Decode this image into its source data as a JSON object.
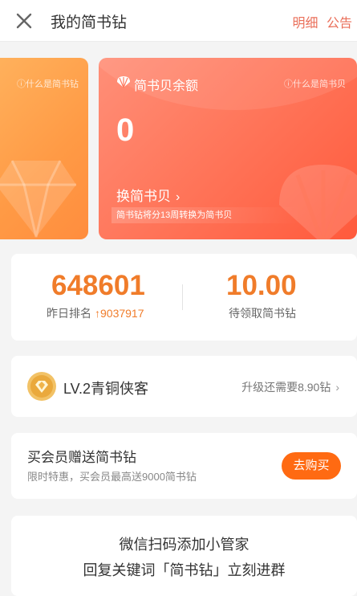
{
  "header": {
    "title": "我的简书钻",
    "action_detail": "明细",
    "action_announcement": "公告"
  },
  "side_card": {
    "faq": "什么是简书钻"
  },
  "balance_card": {
    "label": "简书贝余额",
    "faq": "什么是简书贝",
    "value": "0",
    "exchange_label": "换简书贝",
    "exchange_chevron": "›",
    "note": "简书钻将分13周转换为简书贝"
  },
  "stats": {
    "rank_value": "648601",
    "rank_label": "昨日排名",
    "rank_change_icon": "↑",
    "rank_change": "9037917",
    "pending_value": "10.00",
    "pending_label": "待领取简书钻"
  },
  "level": {
    "name": "LV.2青铜侠客",
    "hint": "升级还需要8.90钻",
    "chevron": "›"
  },
  "member": {
    "title": "买会员赠送简书钻",
    "subtitle": "限时特惠，买会员最高送9000简书钻",
    "button": "去购买"
  },
  "wechat": {
    "line1": "微信扫码添加小管家",
    "line2": "回复关键词「简书钻」立刻进群"
  },
  "colors": {
    "accent": "#f07c2a",
    "header_action": "#ea6f5a",
    "buy_button": "#ff6a12"
  }
}
